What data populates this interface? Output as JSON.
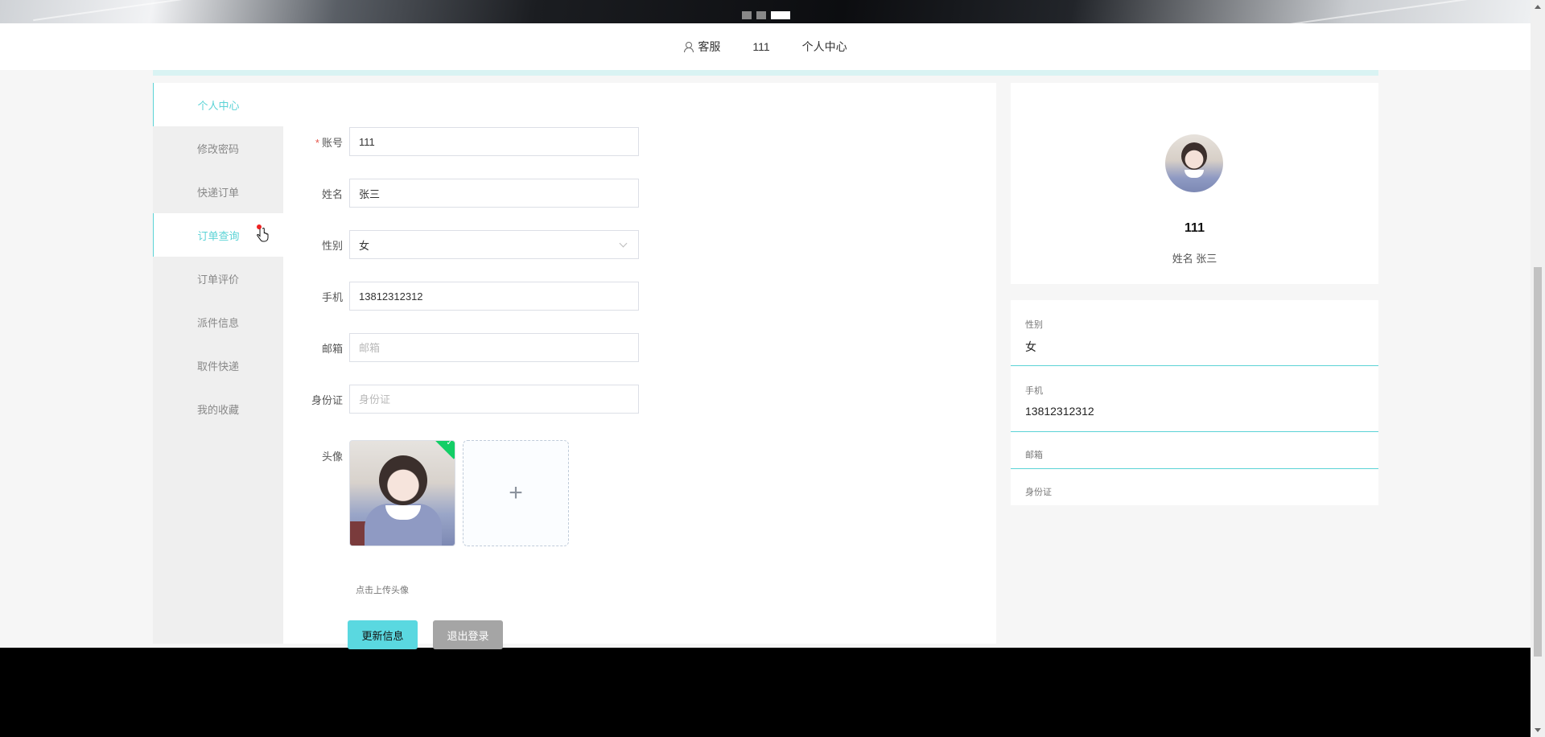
{
  "carousel": {
    "dots": 3,
    "active_index": 2
  },
  "nav": {
    "items": [
      {
        "label": "客服",
        "icon": "user-icon"
      },
      {
        "label": "111"
      },
      {
        "label": "个人中心"
      }
    ]
  },
  "sidebar": {
    "items": [
      {
        "label": "个人中心",
        "state": "active"
      },
      {
        "label": "修改密码"
      },
      {
        "label": "快递订单"
      },
      {
        "label": "订单查询",
        "state": "hover"
      },
      {
        "label": "订单评价"
      },
      {
        "label": "派件信息"
      },
      {
        "label": "取件快递"
      },
      {
        "label": "我的收藏"
      }
    ]
  },
  "form": {
    "account": {
      "label": "账号",
      "required_mark": "*",
      "value": "111"
    },
    "name": {
      "label": "姓名",
      "value": "张三"
    },
    "gender": {
      "label": "性别",
      "value": "女"
    },
    "phone": {
      "label": "手机",
      "value": "13812312312"
    },
    "email": {
      "label": "邮箱",
      "value": "",
      "placeholder": "邮箱"
    },
    "id_card": {
      "label": "身份证",
      "value": "",
      "placeholder": "身份证"
    },
    "avatar": {
      "label": "头像",
      "upload_plus": "+",
      "check": "✓",
      "hint": "点击上传头像"
    },
    "update_button": "更新信息",
    "logout_button": "退出登录"
  },
  "profile": {
    "username": "111",
    "subtitle": "姓名 张三"
  },
  "info": {
    "gender": {
      "label": "性别",
      "value": "女"
    },
    "phone": {
      "label": "手机",
      "value": "13812312312"
    },
    "email": {
      "label": "邮箱",
      "value": ""
    },
    "id_card": {
      "label": "身份证",
      "value": ""
    }
  },
  "colors": {
    "accent": "#5bd3d6",
    "button_primary": "#5ad8e0",
    "button_grey": "#a5a5a5",
    "success": "#13ce66"
  }
}
